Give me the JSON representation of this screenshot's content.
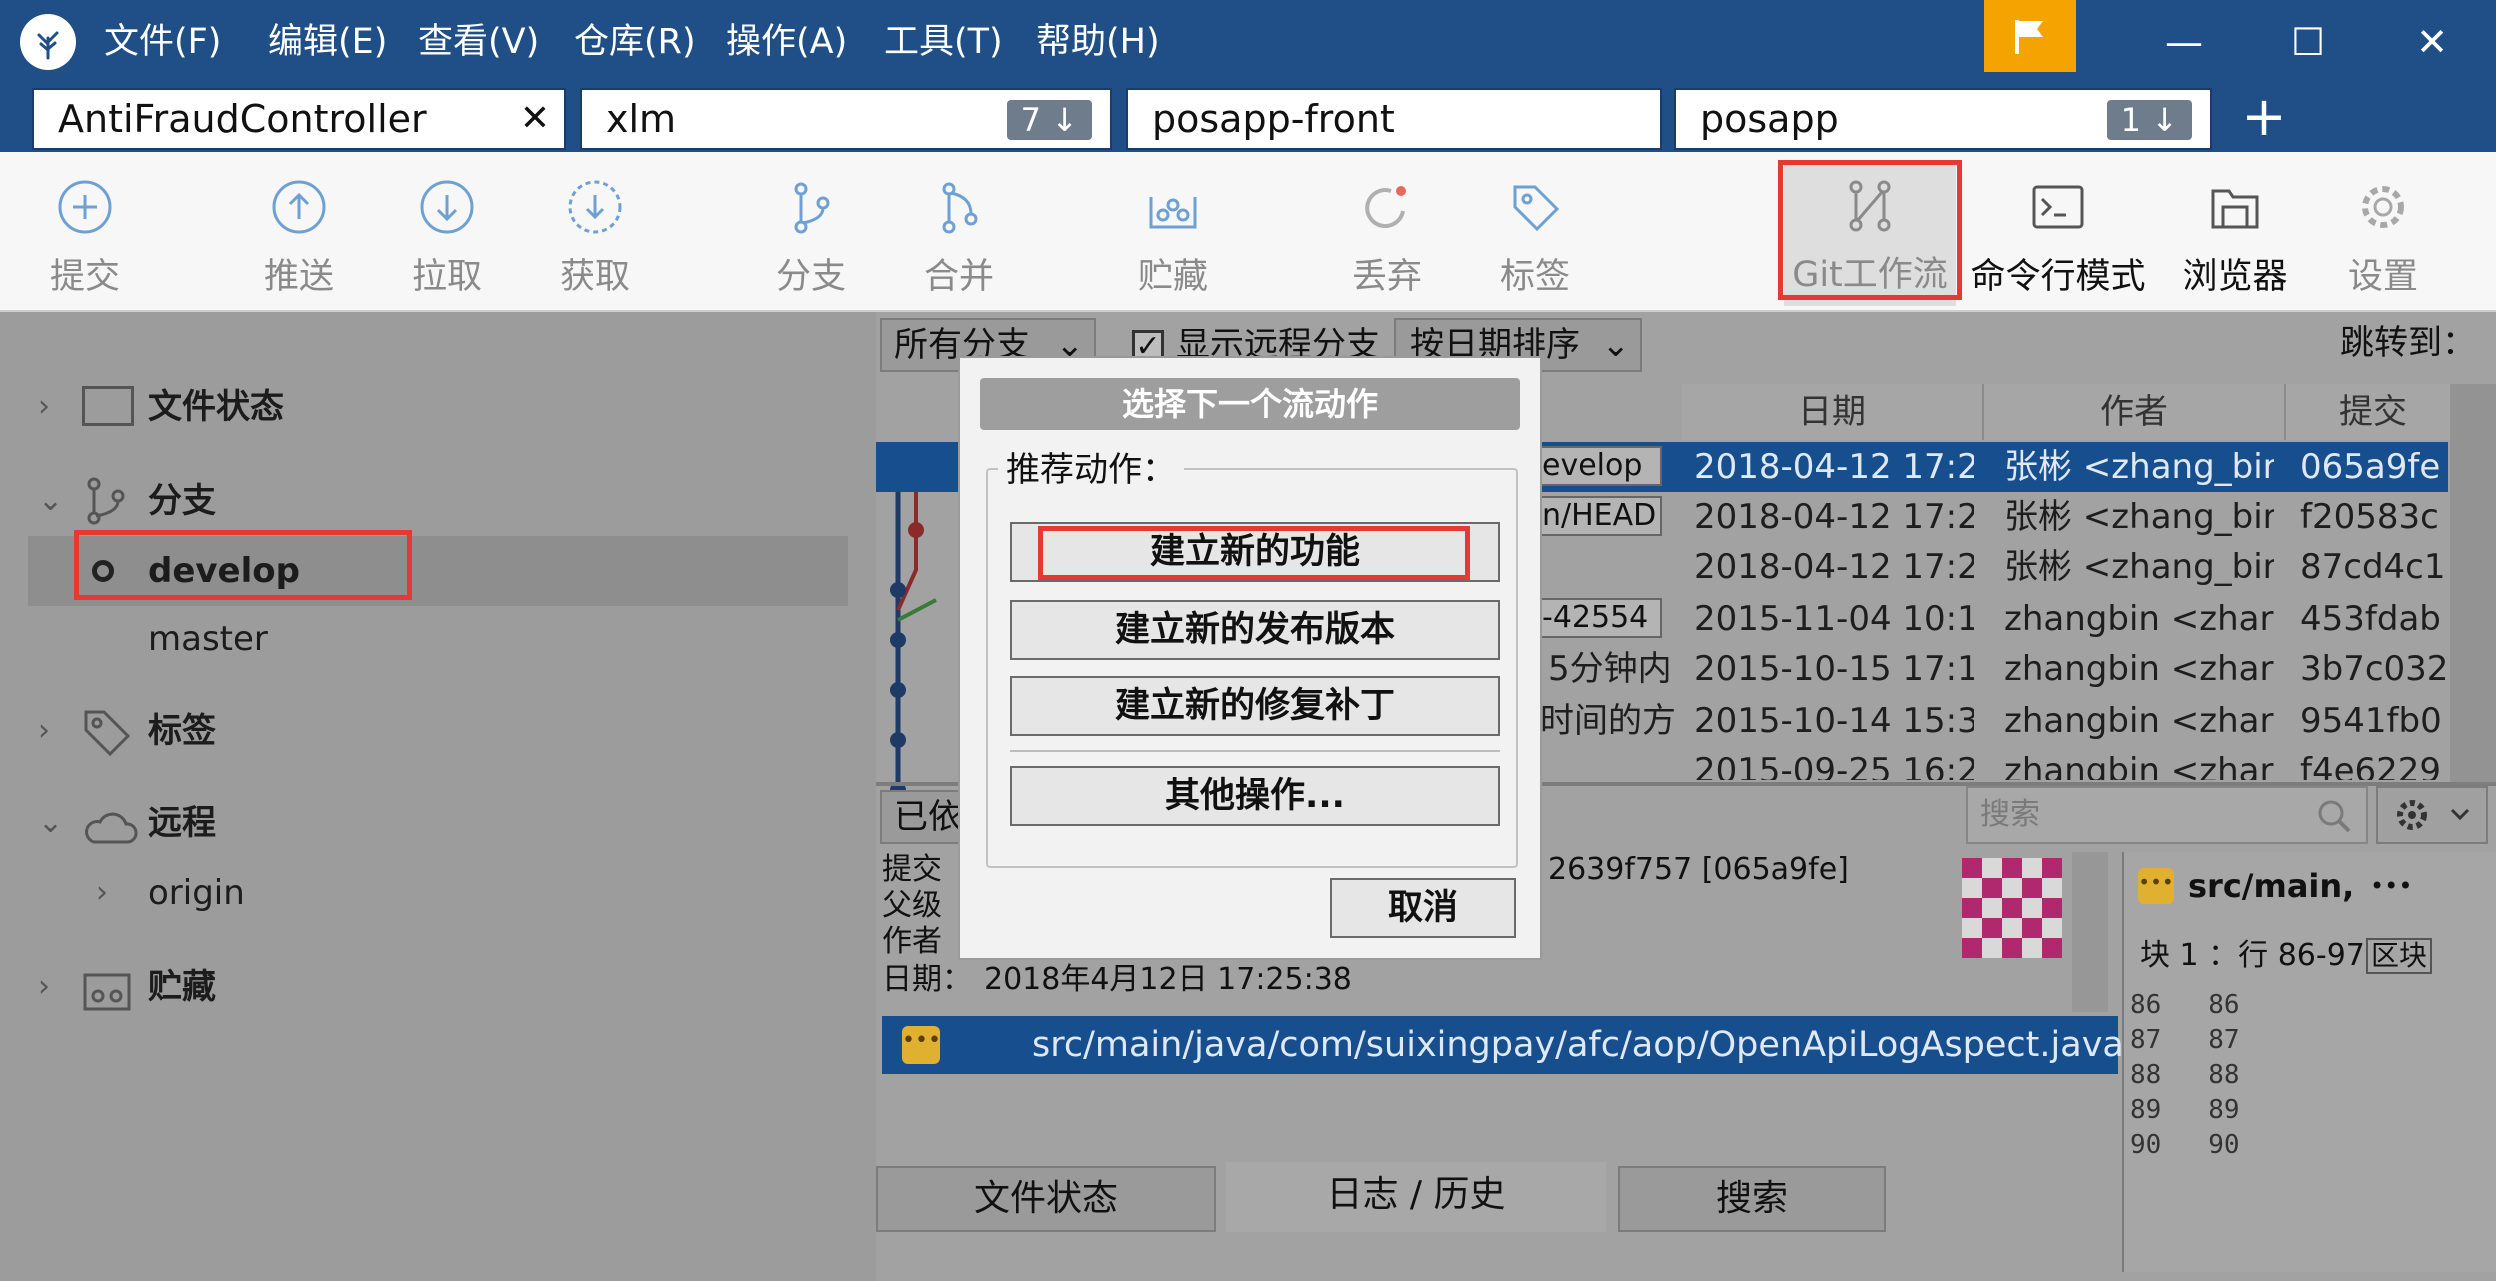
{
  "menu": [
    "文件(F)",
    "编辑(E)",
    "查看(V)",
    "仓库(R)",
    "操作(A)",
    "工具(T)",
    "帮助(H)"
  ],
  "tabs": [
    {
      "label": "AntiFraudController",
      "close": "✕"
    },
    {
      "label": "xlm",
      "badge": "7 ↓"
    },
    {
      "label": "posapp-front"
    },
    {
      "label": "posapp",
      "badge": "1 ↓"
    }
  ],
  "new_tab": "+",
  "window_controls": {
    "minimize": "—",
    "maximize": "☐",
    "close": "✕"
  },
  "toolbar": [
    "提交",
    "推送",
    "拉取",
    "获取",
    "分支",
    "合并",
    "贮藏",
    "丢弃",
    "标签",
    "Git工作流",
    "命令行模式",
    "浏览器",
    "设置"
  ],
  "sidebar": {
    "file_status": "文件状态",
    "branches": "分支",
    "branch_items": [
      "develop",
      "master"
    ],
    "tags": "标签",
    "remotes": "远程",
    "remote_items": [
      "origin"
    ],
    "stash": "贮藏"
  },
  "filter": {
    "branches_select": "所有分支",
    "show_remote": "显示远程分支",
    "sort_select": "按日期排序",
    "jump_to": "跳转到："
  },
  "grid": {
    "headers": [
      "日期",
      "作者",
      "提交"
    ],
    "rows": [
      {
        "desc": "evelop",
        "date": "2018-04-12 17:2",
        "author": "张彬 <zhang_bir",
        "commit": "065a9fe"
      },
      {
        "desc": "n/HEAD",
        "date": "2018-04-12 17:2",
        "author": "张彬 <zhang_bir",
        "commit": "f20583c"
      },
      {
        "desc": "",
        "date": "2018-04-12 17:2",
        "author": "张彬 <zhang_bir",
        "commit": "87cd4c1"
      },
      {
        "desc": "-42554",
        "date": "2015-11-04 10:1",
        "author": "zhangbin <zhar",
        "commit": "453fdab"
      },
      {
        "desc": "5分钟内",
        "date": "2015-10-15 17:1",
        "author": "zhangbin <zhar",
        "commit": "3b7c032"
      },
      {
        "desc": "时间的方",
        "date": "2015-10-14 15:3",
        "author": "zhangbin <zhar",
        "commit": "9541fb0"
      },
      {
        "desc": "",
        "date": "2015-09-25 16:2",
        "author": "zhangbin <zhar",
        "commit": "f4e6229"
      }
    ]
  },
  "detail": {
    "sorted_label": "已依",
    "search_placeholder": "搜索",
    "labels": [
      "提交",
      "父级",
      "作者"
    ],
    "commit_hash": "2639f757 [065a9fe]",
    "date_label": "日期：",
    "date_value": "2018年4月12日 17:25:38",
    "file_path": "src/main/java/com/suixingpay/afc/aop/OpenApiLogAspect.java",
    "diff_file": "src/main,",
    "more": "•••",
    "hunk": "块 1 ：行 86-97",
    "hunk_btn": "区块",
    "line_numbers": [
      "86",
      "87",
      "88",
      "89",
      "90"
    ]
  },
  "bottom_tabs": [
    "文件状态",
    "日志 / 历史",
    "搜索"
  ],
  "dialog": {
    "title": "选择下一个流动作",
    "group": "推荐动作：",
    "actions": [
      "建立新的功能",
      "建立新的发布版本",
      "建立新的修复补丁"
    ],
    "other": "其他操作...",
    "cancel": "取消"
  },
  "colors": {
    "titlebar": "#1f4f86",
    "flag": "#f5a300",
    "highlight_red": "#e53935",
    "selection": "#1a63b8"
  }
}
